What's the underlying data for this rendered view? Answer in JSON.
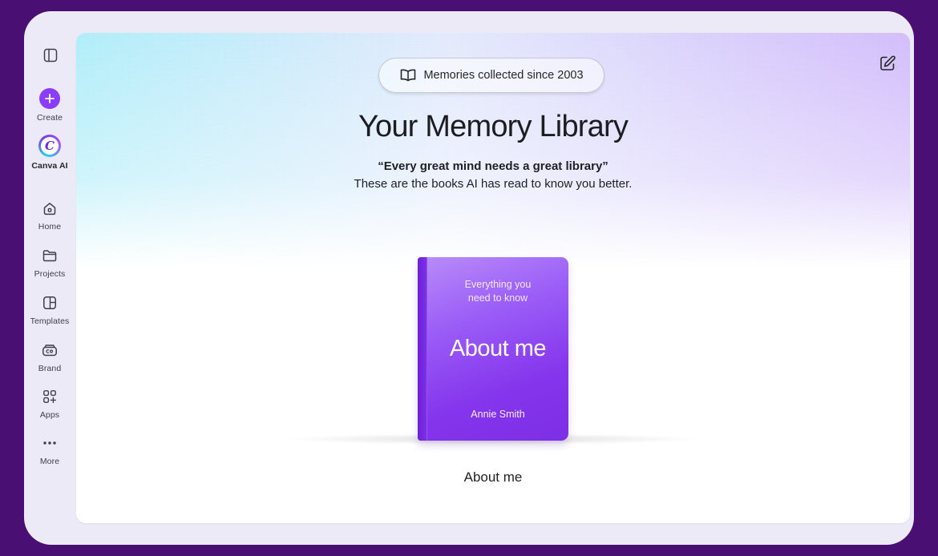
{
  "sidebar": {
    "toggle_icon": "sidebar-panel-icon",
    "items": [
      {
        "label": "Create",
        "icon": "plus-icon"
      },
      {
        "label": "Canva AI",
        "icon": "canva-ai-icon"
      },
      {
        "label": "Home",
        "icon": "home-icon"
      },
      {
        "label": "Projects",
        "icon": "folder-icon"
      },
      {
        "label": "Templates",
        "icon": "templates-icon"
      },
      {
        "label": "Brand",
        "icon": "brand-icon"
      },
      {
        "label": "Apps",
        "icon": "apps-icon"
      },
      {
        "label": "More",
        "icon": "more-icon"
      }
    ],
    "canva_ai_glyph": "C"
  },
  "header": {
    "pill_text": "Memories collected since 2003",
    "pill_icon": "open-book-icon",
    "title": "Your Memory Library",
    "quote": "“Every great mind needs a great library”",
    "subtitle": "These are the books AI has read to know you better.",
    "edit_icon": "edit-icon"
  },
  "book": {
    "top_text_line1": "Everything you",
    "top_text_line2": "need to know",
    "title": "About me",
    "author": "Annie Smith",
    "caption": "About me"
  },
  "colors": {
    "background": "#4a0f72",
    "accent": "#8b3dff",
    "book": "#8535ec"
  }
}
